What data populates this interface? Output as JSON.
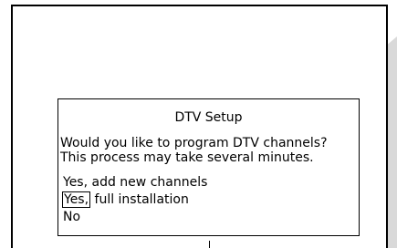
{
  "dialog": {
    "title": "DTV Setup",
    "message_line1": "Would you like to program DTV channels?",
    "message_line2": "This process may take several minutes.",
    "options": [
      {
        "label": "Yes, add new channels"
      },
      {
        "focus_label": "Yes,",
        "rest_label": " full installation",
        "selected": true
      },
      {
        "label": "No"
      }
    ]
  }
}
